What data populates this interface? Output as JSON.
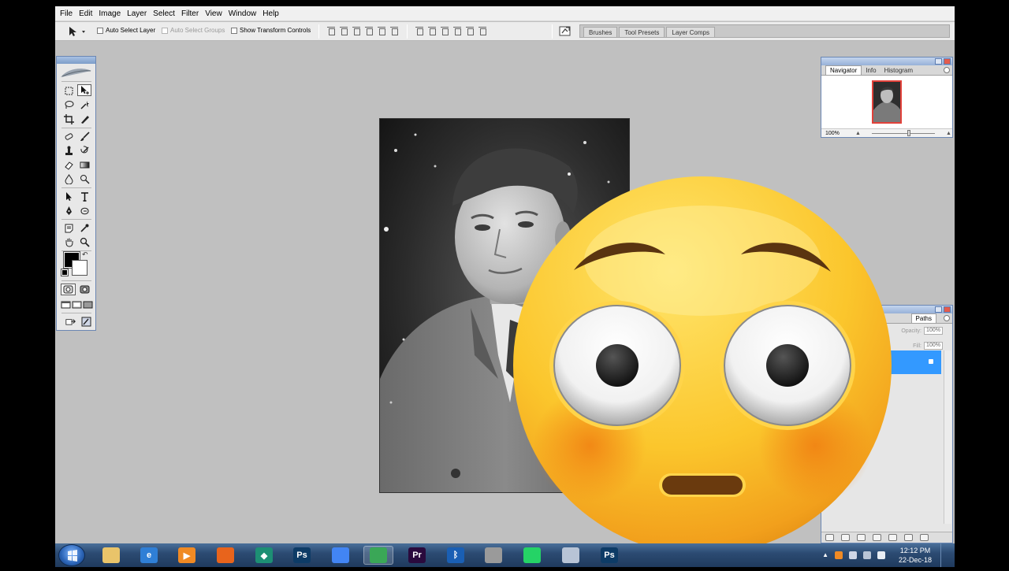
{
  "menu": [
    "File",
    "Edit",
    "Image",
    "Layer",
    "Select",
    "Filter",
    "View",
    "Window",
    "Help"
  ],
  "options": {
    "auto_select_layer": "Auto Select Layer",
    "auto_select_groups": "Auto Select Groups",
    "show_transform_controls": "Show Transform Controls"
  },
  "palette_well_tabs": [
    "Brushes",
    "Tool Presets",
    "Layer Comps"
  ],
  "navigator": {
    "tabs": [
      "Navigator",
      "Info",
      "Histogram"
    ],
    "zoom": "100%"
  },
  "layers": {
    "tab": "Paths",
    "opacity_label": "Opacity:",
    "opacity_value": "100%",
    "fill_label": "Fill:",
    "fill_value": "100%"
  },
  "taskbar": {
    "apps": [
      {
        "name": "windows-explorer",
        "glyph": "",
        "color": "#e9c46a"
      },
      {
        "name": "internet-explorer",
        "glyph": "e",
        "color": "#2f7fd6"
      },
      {
        "name": "media-player",
        "glyph": "▶",
        "color": "#f08a24"
      },
      {
        "name": "firefox",
        "glyph": "",
        "color": "#e8641c"
      },
      {
        "name": "filmora",
        "glyph": "◆",
        "color": "#1d8f74"
      },
      {
        "name": "photoshop",
        "glyph": "Ps",
        "color": "#0d3b66"
      },
      {
        "name": "chrome",
        "glyph": "",
        "color": "#4285f4"
      },
      {
        "name": "coreldraw",
        "glyph": "",
        "color": "#3aa757"
      },
      {
        "name": "premiere",
        "glyph": "Pr",
        "color": "#2a0a3d"
      },
      {
        "name": "bluetooth",
        "glyph": "ᛒ",
        "color": "#1a5fb4"
      },
      {
        "name": "screen-recorder",
        "glyph": "",
        "color": "#9a9a9a"
      },
      {
        "name": "whatsapp",
        "glyph": "",
        "color": "#25d366"
      },
      {
        "name": "film-strip",
        "glyph": "",
        "color": "#b8c4d6"
      },
      {
        "name": "photoshop-2",
        "glyph": "Ps",
        "color": "#0d3b66"
      }
    ],
    "time": "12:12 PM",
    "date": "22-Dec-18"
  }
}
